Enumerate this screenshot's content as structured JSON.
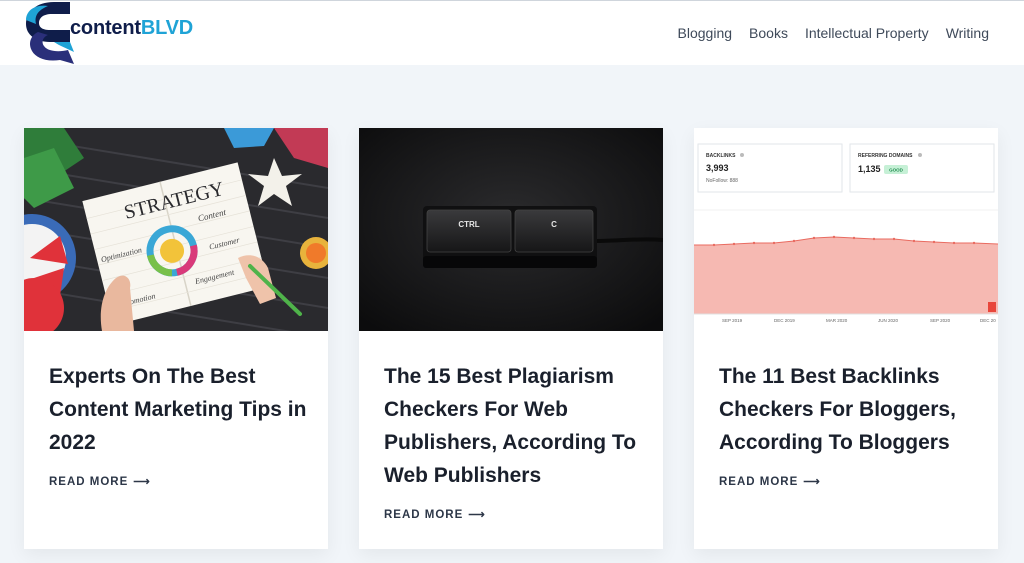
{
  "site": {
    "logo_text_dark": "content",
    "logo_text_accent": "BLVD",
    "brand_dark": "#0f1d4a",
    "brand_accent": "#1fa3d6"
  },
  "nav": {
    "items": [
      {
        "label": "Blogging"
      },
      {
        "label": "Books"
      },
      {
        "label": "Intellectual Property"
      },
      {
        "label": "Writing"
      }
    ]
  },
  "posts": [
    {
      "title": "Experts On The Best Content Marketing Tips in 2022",
      "read_more": "READ MORE",
      "arrow": "⟶",
      "image": {
        "subject": "strategy-notebook",
        "words": [
          "STRATEGY",
          "Content",
          "Optimization",
          "Customer",
          "Promotion",
          "Engagement"
        ]
      }
    },
    {
      "title": "The 15 Best Plagiarism Checkers For Web Publishers, According To Web Publishers",
      "read_more": "READ MORE",
      "arrow": "⟶",
      "image": {
        "subject": "ctrl-c-keys",
        "key_labels": [
          "CTRL",
          "C"
        ]
      }
    },
    {
      "title": "The 11 Best Backlinks Checkers For Bloggers, According To Bloggers",
      "read_more": "READ MORE",
      "arrow": "⟶",
      "image": {
        "subject": "backlinks-chart",
        "stat_1": {
          "label": "BACKLINKS",
          "value": "3,993",
          "sub": "NoFollow: 888"
        },
        "stat_2": {
          "label": "REFERRING DOMAINS",
          "value": "1,135",
          "badge": "GOOD"
        },
        "x_ticks": [
          "SEP 2019",
          "DEC 2019",
          "MAR 2020",
          "JUN 2020",
          "SEP 2020",
          "DEC 20"
        ],
        "series_color": "#f08a80"
      }
    }
  ]
}
